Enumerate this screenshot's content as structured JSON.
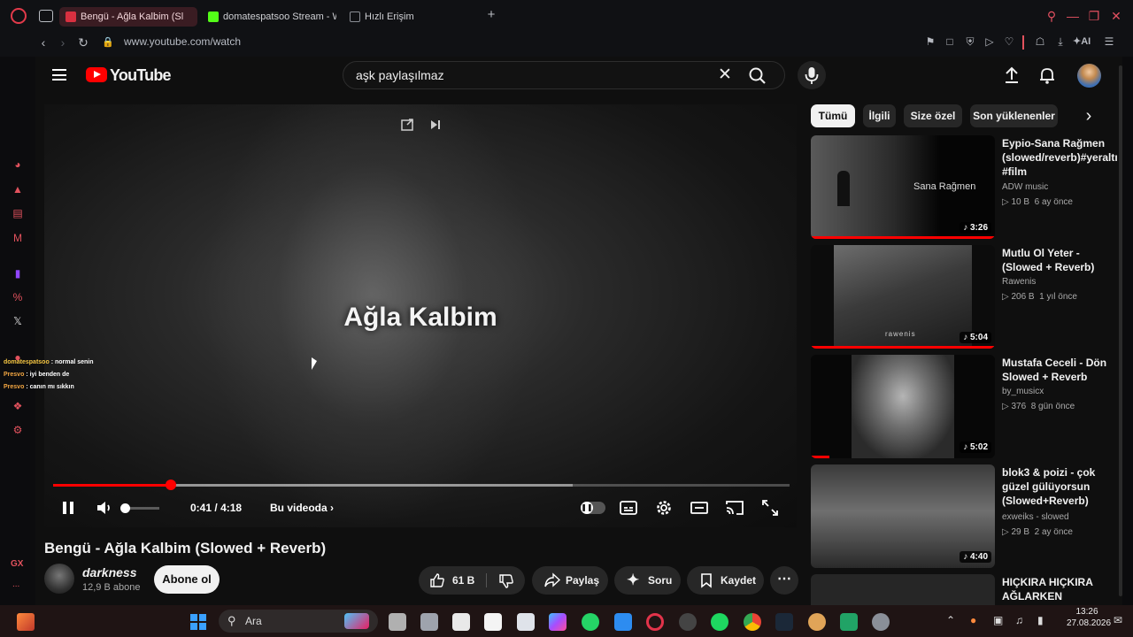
{
  "browser": {
    "tabs": [
      {
        "label": "Bengü - Ağla Kalbim (Sl",
        "color": "#d93040"
      },
      {
        "label": "domatespatsoo Stream - W",
        "color": "#53fc18"
      },
      {
        "label": "Hızlı Erişim",
        "color": "#8a8d94"
      }
    ],
    "new_tab": "+",
    "url": "www.youtube.com/watch",
    "ai_label": "AI",
    "accent": "#e2525d"
  },
  "youtube": {
    "logo_text": "YouTube",
    "search_value": "aşk paylaşılmaz",
    "player": {
      "overlay_title": "Ağla Kalbim",
      "current_time": "0:41",
      "time_sep": "/",
      "duration": "4:18",
      "chapters_label": "Bu videoda",
      "played_fraction": 0.16,
      "buffered_fraction": 0.705
    },
    "video_title": "Bengü - Ağla Kalbim (Slowed + Reverb)",
    "channel_name": "darkness",
    "subscribers": "12,9 B abone",
    "subscribe_label": "Abone ol",
    "actions": {
      "likes": "61 B",
      "share": "Paylaş",
      "ask": "Soru",
      "save": "Kaydet"
    },
    "chips": [
      "Tümü",
      "İlgili",
      "Size özel",
      "Son yüklenenler"
    ],
    "recommendations": [
      {
        "title": "Eypio-Sana Rağmen (slowed/reverb)#yeraltı #film",
        "channel": "ADW music",
        "views": "10 B",
        "age": "6 ay önce",
        "duration": "3:26",
        "thumb_text": "Sana Rağmen",
        "watched": 1.0
      },
      {
        "title": "Mutlu Ol Yeter - (Slowed + Reverb)",
        "channel": "Rawenis",
        "views": "206 B",
        "age": "1 yıl önce",
        "duration": "5:04",
        "thumb_text": "rawenis",
        "watched": 1.0
      },
      {
        "title": "Mustafa Ceceli - Dön Slowed + Reverb",
        "channel": "by_musicx",
        "views": "376",
        "age": "8 gün önce",
        "duration": "5:02",
        "thumb_text": "",
        "watched": 0.1
      },
      {
        "title": "blok3 & poizi - çok güzel gülüyorsun (Slowed+Reverb)",
        "channel": "exweiks - slowed",
        "views": "29 B",
        "age": "2 ay önce",
        "duration": "4:40",
        "thumb_text": "",
        "watched": 0
      },
      {
        "title": "HIÇKIRA HIÇKIRA AĞLARKEN",
        "channel": "",
        "views": "",
        "age": "",
        "duration": "",
        "thumb_text": "",
        "watched": 0
      }
    ]
  },
  "chat": [
    {
      "user": "domatespatsoo",
      "message": ": normal senin",
      "color": "#f4c542"
    },
    {
      "user": "Presvo",
      "message": ": iyi benden de",
      "color": "#f4a742"
    },
    {
      "user": "Presvo",
      "message": ": canın mı sıkkın",
      "color": "#f4a742"
    }
  ],
  "sidebar": {
    "gx_label": "GX",
    "more_label": "..."
  },
  "taskbar": {
    "search_placeholder": "Ara",
    "time": "13:26",
    "date": "27.08.2026"
  }
}
